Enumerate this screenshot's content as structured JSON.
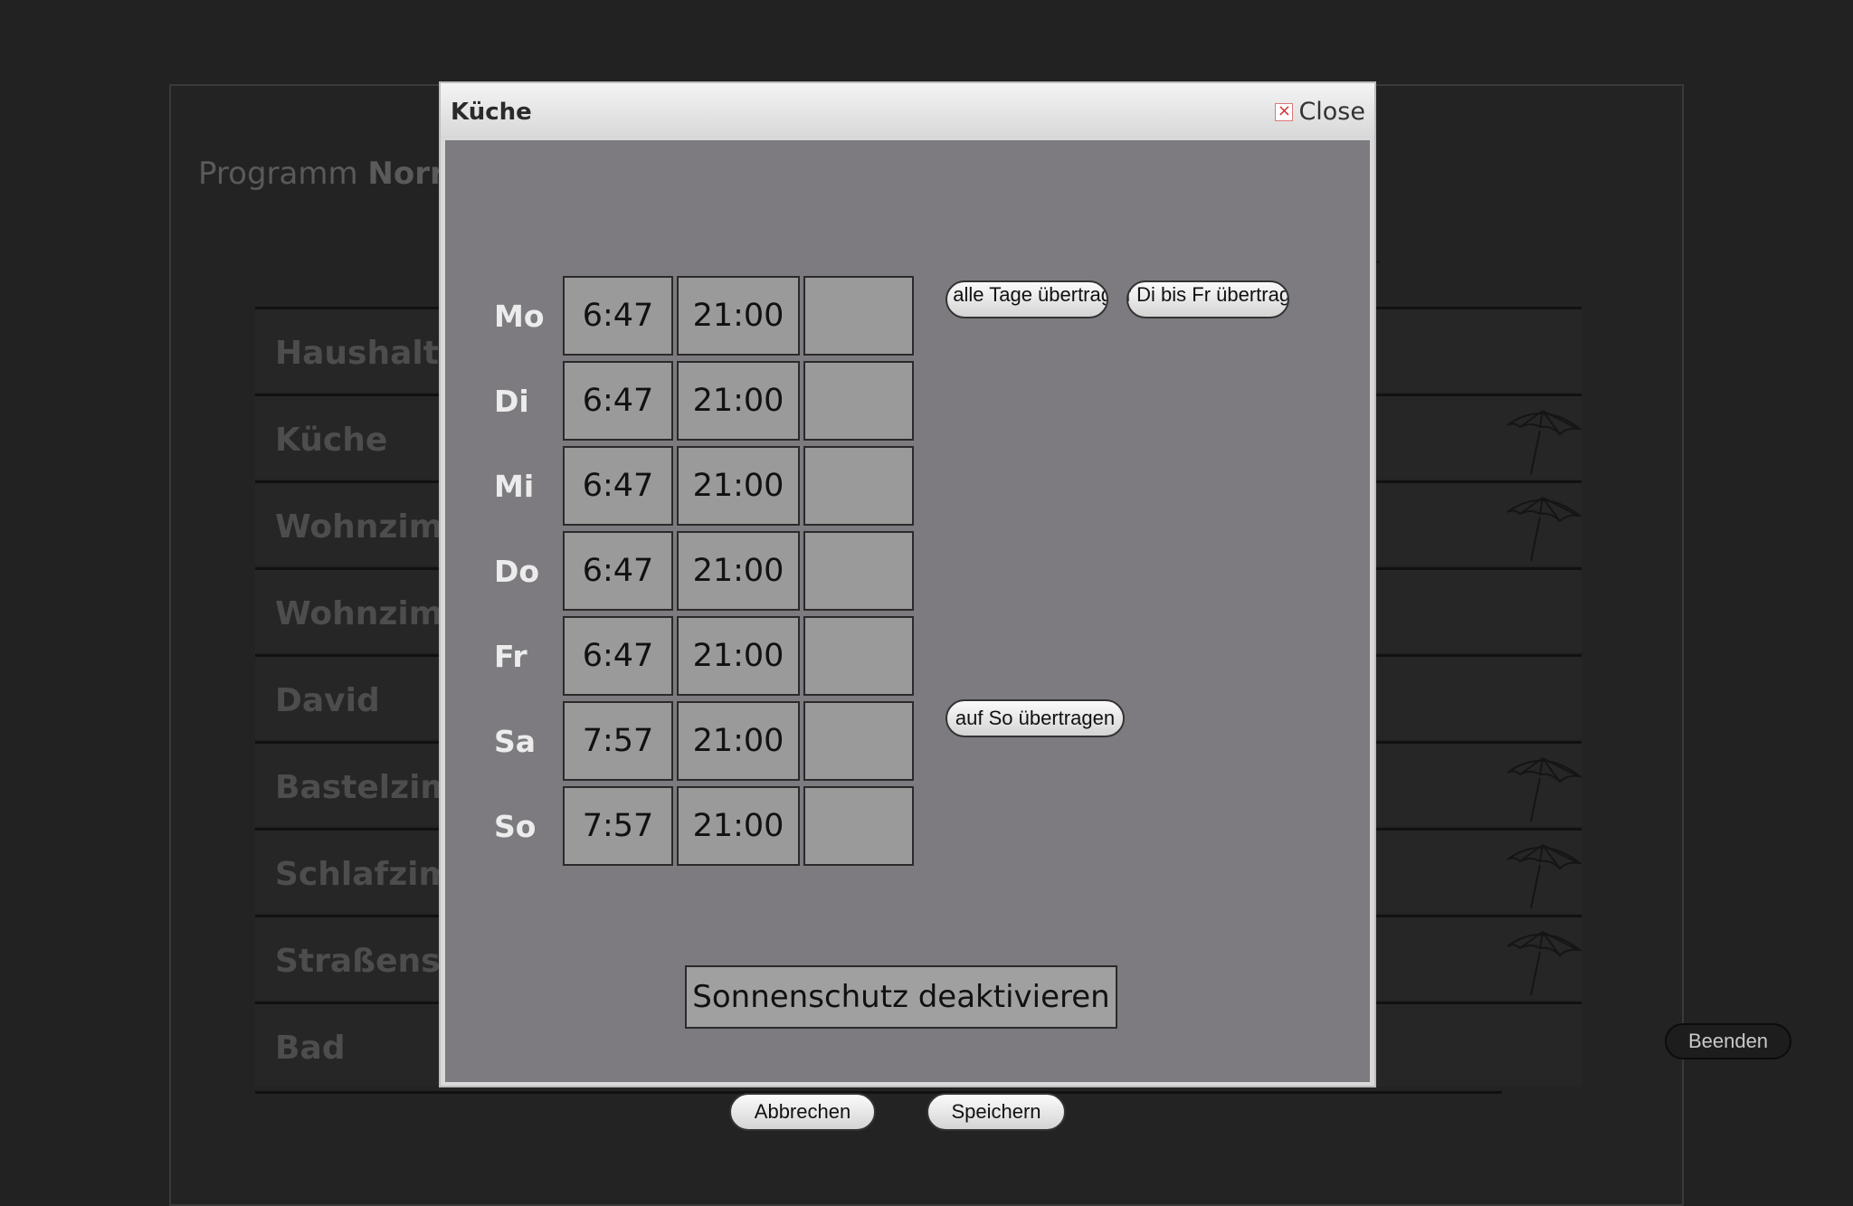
{
  "background": {
    "program_prefix": "Programm",
    "program_name": "Norr",
    "rooms": [
      {
        "name": "Haushalts",
        "sun_protection": false
      },
      {
        "name": "Küche",
        "sun_protection": true
      },
      {
        "name": "Wohnzimr",
        "sun_protection": true
      },
      {
        "name": "Wohnzimr",
        "sun_protection": false
      },
      {
        "name": "David",
        "sun_protection": false
      },
      {
        "name": "Bastelzim",
        "sun_protection": true
      },
      {
        "name": "Schlafzim",
        "sun_protection": true
      },
      {
        "name": "Straßense",
        "sun_protection": true
      },
      {
        "name": "Bad",
        "sun_protection": false
      }
    ],
    "sun_icon": "umbrella-icon",
    "exit_label": "Beenden"
  },
  "dialog": {
    "title": "Küche",
    "close_label": "Close",
    "columns": [
      {
        "icon": "arrow-up-icon"
      },
      {
        "icon": "arrow-down-icon"
      },
      {
        "icon": "arrow-down-small-icon"
      }
    ],
    "schedule": [
      {
        "day": "Mo",
        "up": "6:47",
        "down": "21:00",
        "shade": ""
      },
      {
        "day": "Di",
        "up": "6:47",
        "down": "21:00",
        "shade": ""
      },
      {
        "day": "Mi",
        "up": "6:47",
        "down": "21:00",
        "shade": ""
      },
      {
        "day": "Do",
        "up": "6:47",
        "down": "21:00",
        "shade": ""
      },
      {
        "day": "Fr",
        "up": "6:47",
        "down": "21:00",
        "shade": ""
      },
      {
        "day": "Sa",
        "up": "7:57",
        "down": "21:00",
        "shade": ""
      },
      {
        "day": "So",
        "up": "7:57",
        "down": "21:00",
        "shade": ""
      }
    ],
    "copy_all_label": "auf alle Tage übertragen",
    "copy_tue_fri_label": "auf Di bis Fr übertragen",
    "copy_sun_label": "auf So übertragen",
    "deactivate_label": "Sonnenschutz deaktivieren",
    "cancel_label": "Abbrechen",
    "save_label": "Speichern"
  },
  "colors": {
    "arrow": "#2fb5e6",
    "dialog_body": "#7d7b80",
    "cell": "#9a9a9a"
  }
}
